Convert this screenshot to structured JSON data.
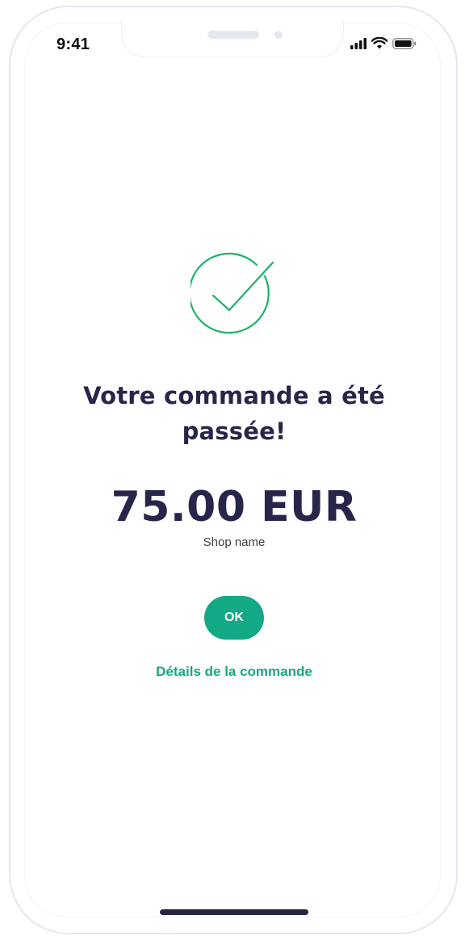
{
  "status_bar": {
    "time": "9:41",
    "icons": [
      "cellular-signal-icon",
      "wifi-icon",
      "battery-icon"
    ]
  },
  "confirmation": {
    "icon": "check-circle-icon",
    "title": "Votre commande a été passée!",
    "amount": "75.00 EUR",
    "shop_name": "Shop name",
    "ok_label": "OK",
    "details_link": "Détails de la commande"
  },
  "colors": {
    "accent": "#12a984",
    "success_icon": "#1bb26a",
    "heading": "#27264a",
    "home_indicator": "#25243f"
  }
}
